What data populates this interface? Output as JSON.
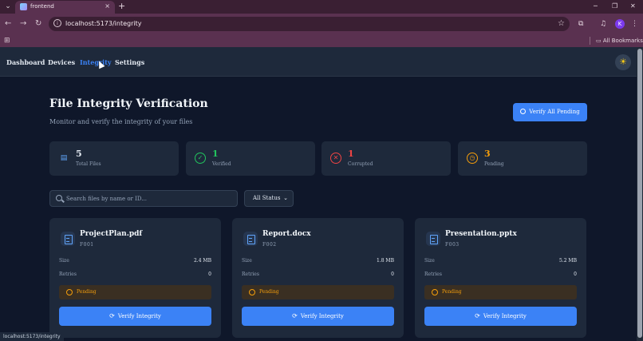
{
  "browser": {
    "tab_title": "frontend",
    "tab_close": "×",
    "new_tab": "+",
    "url": "localhost:5173/integrity",
    "bookmarks_label": "All Bookmarks",
    "profile_initial": "K",
    "status_url": "localhost:5173/integrity"
  },
  "nav": {
    "items": [
      {
        "label": "Dashboard",
        "active": false
      },
      {
        "label": "Devices",
        "active": false
      },
      {
        "label": "Integrity",
        "active": true
      },
      {
        "label": "Settings",
        "active": false
      }
    ]
  },
  "header": {
    "title": "File Integrity Verification",
    "subtitle": "Monitor and verify the integrity of your files",
    "verify_all_label": "Verify All Pending"
  },
  "stats": [
    {
      "value": "5",
      "label": "Total Files",
      "color": "#e2e8f0",
      "icon": "document-icon"
    },
    {
      "value": "1",
      "label": "Verified",
      "color": "#22c55e",
      "icon": "check-circle-icon"
    },
    {
      "value": "1",
      "label": "Corrupted",
      "color": "#ef4444",
      "icon": "x-circle-icon"
    },
    {
      "value": "3",
      "label": "Pending",
      "color": "#f59e0b",
      "icon": "clock-icon"
    }
  ],
  "filters": {
    "search_placeholder": "Search files by name or ID...",
    "status_selected": "All Status"
  },
  "meta_labels": {
    "size": "Size",
    "retries": "Retries"
  },
  "files": [
    {
      "name": "ProjectPlan.pdf",
      "id": "F001",
      "size": "2.4 MB",
      "retries": "0",
      "status": "Pending",
      "button": "Verify Integrity"
    },
    {
      "name": "Report.docx",
      "id": "F002",
      "size": "1.8 MB",
      "retries": "0",
      "status": "Pending",
      "button": "Verify Integrity"
    },
    {
      "name": "Presentation.pptx",
      "id": "F003",
      "size": "5.2 MB",
      "retries": "0",
      "status": "Pending",
      "button": "Verify Integrity"
    }
  ],
  "colors": {
    "accent": "#3b82f6",
    "background": "#0f172a",
    "card": "#1e293b",
    "pending": "#f59e0b"
  }
}
